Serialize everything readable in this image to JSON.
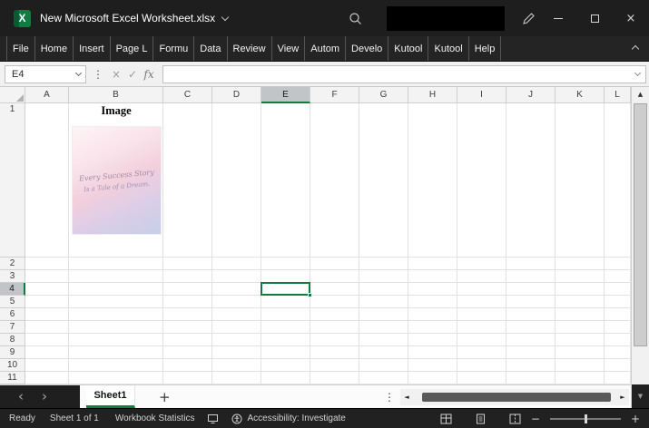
{
  "window": {
    "title": "New Microsoft Excel Worksheet.xlsx",
    "app_initial": "X"
  },
  "ribbon": {
    "tabs": [
      "File",
      "Home",
      "Insert",
      "Page L",
      "Formu",
      "Data",
      "Review",
      "View",
      "Autom",
      "Develo",
      "Kutool",
      "Kutool",
      "Help"
    ]
  },
  "formula_bar": {
    "name_box_value": "E4",
    "formula_value": ""
  },
  "grid": {
    "columns": [
      "A",
      "B",
      "C",
      "D",
      "E",
      "F",
      "G",
      "H",
      "I",
      "J",
      "K",
      "L"
    ],
    "rows": [
      "1",
      "2",
      "3",
      "4",
      "5",
      "6",
      "7",
      "8",
      "9",
      "10",
      "11"
    ],
    "selected_cell": "E4",
    "selected_column": "E",
    "selected_row": "4",
    "cells": {
      "B1": "Image"
    },
    "picture_caption": {
      "line1": "Every Success Story",
      "line2": "Is a Tale of a Dream."
    }
  },
  "sheet_bar": {
    "active_tab": "Sheet1"
  },
  "status_bar": {
    "mode": "Ready",
    "sheet_info": "Sheet 1 of 1",
    "workbook_statistics": "Workbook Statistics",
    "accessibility": "Accessibility: Investigate"
  },
  "icons": {
    "close": "×",
    "cancel": "×",
    "enter": "✓",
    "fx": "fx",
    "dots_vertical": "⋮",
    "arrow_up": "▲",
    "arrow_down": "▼",
    "arrow_left": "◄",
    "arrow_right": "►",
    "chev_left": "‹",
    "chev_right": "›",
    "zoom_out": "−",
    "zoom_in": "+",
    "add_sheet": "+"
  },
  "colors": {
    "accent_green": "#107C41",
    "titlebar_bg": "#1E1E1E",
    "selection_border": "#107C41"
  }
}
